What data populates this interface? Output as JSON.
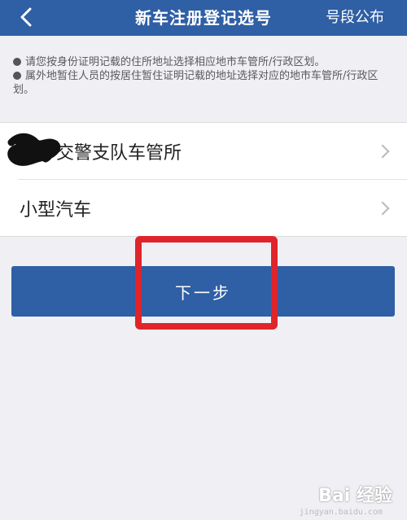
{
  "header": {
    "back_icon": "back-arrow-icon",
    "title": "新车注册登记选号",
    "action_label": "号段公布"
  },
  "notes": [
    "请您按身份证明记载的住所地址选择相应地市车管所/行政区划。",
    "属外地暂住人员的按居住暂住证明记载的地址选择对应的地市车管所/行政区划。"
  ],
  "list": {
    "items": [
      {
        "label": "交警支队车管所",
        "redacted_prefix": true
      },
      {
        "label": "小型汽车",
        "redacted_prefix": false
      }
    ]
  },
  "next_button": {
    "label": "下一步"
  },
  "watermark": {
    "brand": "Bai 经验",
    "url": "jingyan.baidu.com"
  },
  "colors": {
    "primary": "#2f5fa4",
    "highlight": "#e0242b",
    "background": "#efeff4"
  }
}
